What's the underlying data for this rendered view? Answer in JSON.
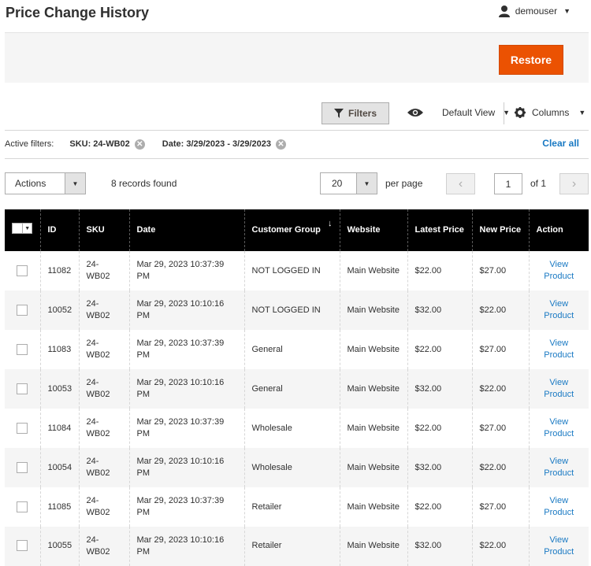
{
  "header": {
    "title": "Price Change History",
    "username": "demouser"
  },
  "action_bar": {
    "restore_label": "Restore"
  },
  "toolbar": {
    "filters_label": "Filters",
    "view_label": "Default View",
    "columns_label": "Columns"
  },
  "active_filters": {
    "label": "Active filters:",
    "chips": [
      "SKU: 24-WB02",
      "Date: 3/29/2023 - 3/29/2023"
    ],
    "clear_all": "Clear all"
  },
  "grid_controls": {
    "actions_label": "Actions",
    "records_found": "8 records found",
    "per_page_value": "20",
    "per_page_label": "per page",
    "current_page": "1",
    "of_pages": "of 1"
  },
  "table": {
    "columns": [
      "ID",
      "SKU",
      "Date",
      "Customer Group",
      "Website",
      "Latest Price",
      "New Price",
      "Action"
    ],
    "sort_indicator": "↓",
    "rows": [
      {
        "id": "11082",
        "sku": "24-WB02",
        "date": "Mar 29, 2023 10:37:39 PM",
        "group": "NOT LOGGED IN",
        "website": "Main Website",
        "latest": "$22.00",
        "new": "$27.00",
        "action": "View Product"
      },
      {
        "id": "10052",
        "sku": "24-WB02",
        "date": "Mar 29, 2023 10:10:16 PM",
        "group": "NOT LOGGED IN",
        "website": "Main Website",
        "latest": "$32.00",
        "new": "$22.00",
        "action": "View Product"
      },
      {
        "id": "11083",
        "sku": "24-WB02",
        "date": "Mar 29, 2023 10:37:39 PM",
        "group": "General",
        "website": "Main Website",
        "latest": "$22.00",
        "new": "$27.00",
        "action": "View Product"
      },
      {
        "id": "10053",
        "sku": "24-WB02",
        "date": "Mar 29, 2023 10:10:16 PM",
        "group": "General",
        "website": "Main Website",
        "latest": "$32.00",
        "new": "$22.00",
        "action": "View Product"
      },
      {
        "id": "11084",
        "sku": "24-WB02",
        "date": "Mar 29, 2023 10:37:39 PM",
        "group": "Wholesale",
        "website": "Main Website",
        "latest": "$22.00",
        "new": "$27.00",
        "action": "View Product"
      },
      {
        "id": "10054",
        "sku": "24-WB02",
        "date": "Mar 29, 2023 10:10:16 PM",
        "group": "Wholesale",
        "website": "Main Website",
        "latest": "$32.00",
        "new": "$22.00",
        "action": "View Product"
      },
      {
        "id": "11085",
        "sku": "24-WB02",
        "date": "Mar 29, 2023 10:37:39 PM",
        "group": "Retailer",
        "website": "Main Website",
        "latest": "$22.00",
        "new": "$27.00",
        "action": "View Product"
      },
      {
        "id": "10055",
        "sku": "24-WB02",
        "date": "Mar 29, 2023 10:10:16 PM",
        "group": "Retailer",
        "website": "Main Website",
        "latest": "$32.00",
        "new": "$22.00",
        "action": "View Product"
      }
    ]
  },
  "colors": {
    "accent_orange": "#eb5202",
    "link_blue": "#1979c3",
    "header_black": "#000000"
  }
}
